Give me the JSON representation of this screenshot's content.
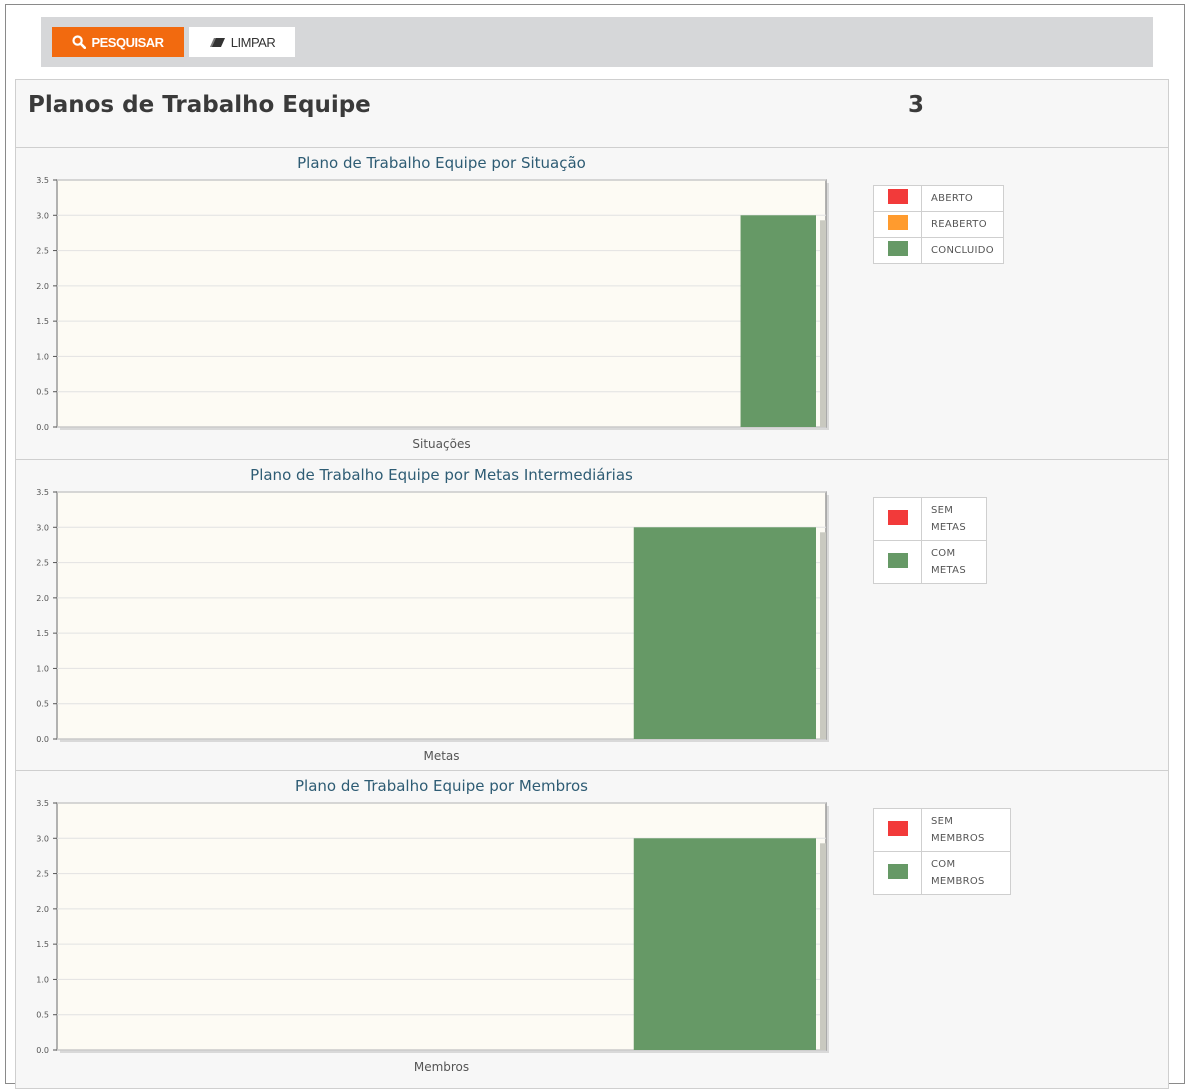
{
  "toolbar": {
    "search_label": "PESQUISAR",
    "clear_label": "LIMPAR",
    "search_icon": "search-icon",
    "clear_icon": "eraser-icon"
  },
  "panel": {
    "title": "Planos de Trabalho Equipe",
    "count": "3"
  },
  "colors": {
    "accent": "#f26a0f",
    "red": "#f23a3a",
    "orange": "#ff9b2e",
    "green": "#669966",
    "plot_bg": "#fdfbf4"
  },
  "chart_data": [
    {
      "type": "bar",
      "title": "Plano de Trabalho Equipe por Situação",
      "xlabel": "Situações",
      "ylabel": "",
      "categories": [
        "ABERTO",
        "REABERTO",
        "CONCLUIDO"
      ],
      "series": [
        {
          "name": "ABERTO",
          "color": "#f23a3a",
          "values": [
            0,
            0,
            0
          ]
        },
        {
          "name": "REABERTO",
          "color": "#ff9b2e",
          "values": [
            0,
            0,
            0
          ]
        },
        {
          "name": "CONCLUIDO",
          "color": "#669966",
          "values": [
            0,
            0,
            3
          ]
        }
      ],
      "ylim": [
        0,
        3.5
      ],
      "yticks": [
        "0.0",
        "0.5",
        "1.0",
        "1.5",
        "2.0",
        "2.5",
        "3.0",
        "3.5"
      ],
      "legend": [
        {
          "label": "ABERTO",
          "color": "#f23a3a"
        },
        {
          "label": "REABERTO",
          "color": "#ff9b2e"
        },
        {
          "label": "CONCLUIDO",
          "color": "#669966"
        }
      ],
      "grid": true,
      "legend_position": "right"
    },
    {
      "type": "bar",
      "title": "Plano de Trabalho Equipe por Metas Intermediárias",
      "xlabel": "Metas",
      "ylabel": "",
      "categories": [
        "SEM METAS",
        "COM METAS"
      ],
      "series": [
        {
          "name": "SEM METAS",
          "color": "#f23a3a",
          "values": [
            0,
            0
          ]
        },
        {
          "name": "COM METAS",
          "color": "#669966",
          "values": [
            0,
            3
          ]
        }
      ],
      "ylim": [
        0,
        3.5
      ],
      "yticks": [
        "0.0",
        "0.5",
        "1.0",
        "1.5",
        "2.0",
        "2.5",
        "3.0",
        "3.5"
      ],
      "legend": [
        {
          "label": "SEM METAS",
          "color": "#f23a3a"
        },
        {
          "label": "COM METAS",
          "color": "#669966"
        }
      ],
      "grid": true,
      "legend_position": "right"
    },
    {
      "type": "bar",
      "title": "Plano de Trabalho Equipe por Membros",
      "xlabel": "Membros",
      "ylabel": "",
      "categories": [
        "SEM MEMBROS",
        "COM MEMBROS"
      ],
      "series": [
        {
          "name": "SEM MEMBROS",
          "color": "#f23a3a",
          "values": [
            0,
            0
          ]
        },
        {
          "name": "COM MEMBROS",
          "color": "#669966",
          "values": [
            0,
            3
          ]
        }
      ],
      "ylim": [
        0,
        3.5
      ],
      "yticks": [
        "0.0",
        "0.5",
        "1.0",
        "1.5",
        "2.0",
        "2.5",
        "3.0",
        "3.5"
      ],
      "legend": [
        {
          "label": "SEM MEMBROS",
          "color": "#f23a3a"
        },
        {
          "label": "COM MEMBROS",
          "color": "#669966"
        }
      ],
      "grid": true,
      "legend_position": "right"
    }
  ]
}
